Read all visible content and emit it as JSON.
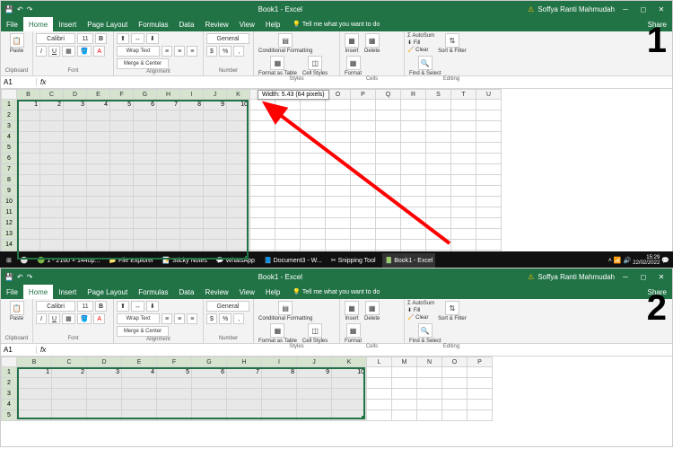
{
  "app": {
    "title": "Book1 - Excel",
    "user": "Soffya Ranti Mahmudah"
  },
  "qat": {
    "save": "💾",
    "undo": "↶",
    "redo": "↷"
  },
  "tabs": [
    "File",
    "Home",
    "Insert",
    "Page Layout",
    "Formulas",
    "Data",
    "Review",
    "View",
    "Help"
  ],
  "active_tab": "Home",
  "tell_me": "Tell me what you want to do",
  "share": "Share",
  "ribbon": {
    "clipboard": {
      "label": "Clipboard",
      "paste": "Paste"
    },
    "font": {
      "label": "Font",
      "name": "Calibri",
      "size": "11"
    },
    "alignment": {
      "label": "Alignment",
      "wrap": "Wrap Text",
      "merge": "Merge & Center"
    },
    "number": {
      "label": "Number",
      "format": "General"
    },
    "styles": {
      "label": "Styles",
      "cf": "Conditional Formatting",
      "fat": "Format as Table",
      "cs": "Cell Styles"
    },
    "cells": {
      "label": "Cells",
      "insert": "Insert",
      "delete": "Delete",
      "format": "Format"
    },
    "editing": {
      "label": "Editing",
      "sum": "AutoSum",
      "fill": "Fill",
      "clear": "Clear",
      "sort": "Sort & Filter",
      "find": "Find & Select"
    }
  },
  "namebox": "A1",
  "tooltip": "Width: 5.43 (64 pixels)",
  "columns_1": [
    "B",
    "C",
    "D",
    "E",
    "F",
    "G",
    "H",
    "I",
    "J",
    "K",
    "L",
    "M",
    "N",
    "O",
    "P",
    "Q",
    "R",
    "S",
    "T",
    "U"
  ],
  "columns_2": [
    "B",
    "C",
    "D",
    "E",
    "F",
    "G",
    "H",
    "I",
    "J",
    "K",
    "L",
    "M",
    "N",
    "O",
    "P"
  ],
  "col_w1_sel": 26,
  "col_w1_rest": 28,
  "col_w2_sel": 39,
  "col_w2_rest": 28,
  "data_row": [
    1,
    2,
    3,
    4,
    5,
    6,
    7,
    8,
    9,
    10
  ],
  "rows_count_1": 15,
  "rows_count_2": 5,
  "taskbar": {
    "items": [
      "1 - 2160 × 1440p...",
      "File Explorer",
      "Sticky Notes",
      "WhatsApp",
      "Document3 - W...",
      "Snipping Tool"
    ],
    "active": "Book1 - Excel",
    "time": "15:29",
    "date": "22/02/2022"
  },
  "annotations": {
    "num1": "1",
    "num2": "2"
  }
}
